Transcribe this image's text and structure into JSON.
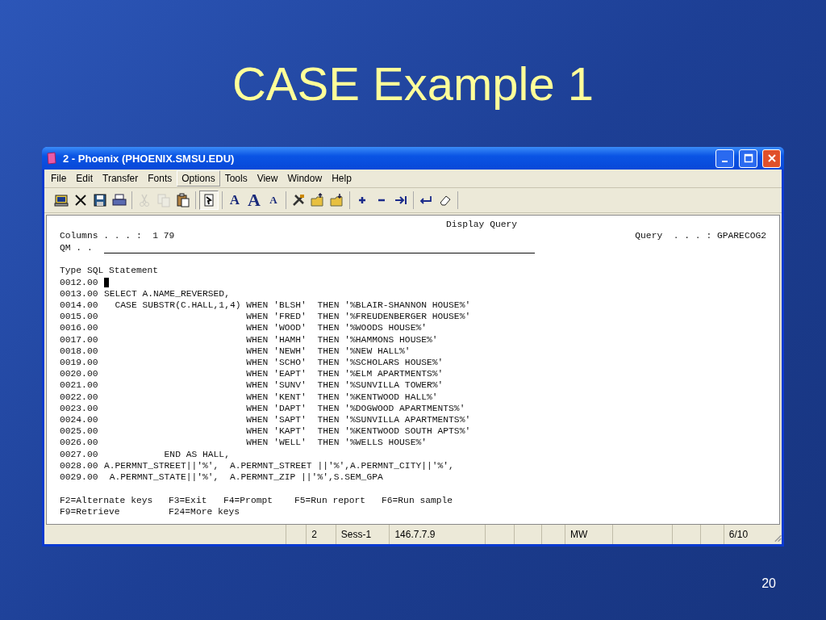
{
  "slide": {
    "title": "CASE Example 1",
    "page_number": "20"
  },
  "window": {
    "title": "2 - Phoenix (PHOENIX.SMSU.EDU)"
  },
  "menu": [
    {
      "label": "File",
      "selected": false
    },
    {
      "label": "Edit",
      "selected": false
    },
    {
      "label": "Transfer",
      "selected": false
    },
    {
      "label": "Fonts",
      "selected": false
    },
    {
      "label": "Options",
      "selected": true
    },
    {
      "label": "Tools",
      "selected": false
    },
    {
      "label": "View",
      "selected": false
    },
    {
      "label": "Window",
      "selected": false
    },
    {
      "label": "Help",
      "selected": false
    }
  ],
  "toolbar": [
    [
      {
        "kind": "monitor",
        "disabled": false
      },
      {
        "kind": "close",
        "disabled": false
      },
      {
        "kind": "save",
        "disabled": false
      },
      {
        "kind": "print",
        "disabled": false
      }
    ],
    [
      {
        "kind": "cut",
        "disabled": true
      },
      {
        "kind": "copy",
        "disabled": true
      },
      {
        "kind": "paste",
        "disabled": false
      }
    ],
    [
      {
        "kind": "page",
        "disabled": false
      }
    ],
    [
      {
        "kind": "font",
        "label": "A",
        "disabled": false
      },
      {
        "kind": "font-up",
        "label": "A",
        "disabled": false
      },
      {
        "kind": "font-down",
        "label": "A",
        "disabled": false
      }
    ],
    [
      {
        "kind": "tools",
        "disabled": false
      },
      {
        "kind": "folder-up",
        "disabled": false
      },
      {
        "kind": "folder-down",
        "disabled": false
      }
    ],
    [
      {
        "kind": "plus",
        "disabled": false
      },
      {
        "kind": "minus",
        "disabled": false
      },
      {
        "kind": "tab",
        "disabled": false
      }
    ],
    [
      {
        "kind": "enter",
        "disabled": false
      },
      {
        "kind": "eraser",
        "disabled": false
      }
    ]
  ],
  "terminal": {
    "heading": "Display Query",
    "columns_label": "Columns . . . :  1 79",
    "query_label": "Query  . . . : GPARECOG2",
    "qm_label": "QM . .",
    "section": "Type SQL Statement",
    "lines": [
      {
        "number": "0012.00",
        "cursor": true
      },
      {
        "number": "0013.00",
        "text": "SELECT A.NAME_REVERSED,",
        "cursor": false
      },
      {
        "number": "0014.00",
        "text": "  CASE SUBSTR(C.HALL,1,4) WHEN 'BLSH'  THEN '%BLAIR-SHANNON HOUSE%'",
        "cursor": false
      },
      {
        "number": "0015.00",
        "text": "                          WHEN 'FRED'  THEN '%FREUDENBERGER HOUSE%'",
        "cursor": false
      },
      {
        "number": "0016.00",
        "text": "                          WHEN 'WOOD'  THEN '%WOODS HOUSE%'",
        "cursor": false
      },
      {
        "number": "0017.00",
        "text": "                          WHEN 'HAMH'  THEN '%HAMMONS HOUSE%'",
        "cursor": false
      },
      {
        "number": "0018.00",
        "text": "                          WHEN 'NEWH'  THEN '%NEW HALL%'",
        "cursor": false
      },
      {
        "number": "0019.00",
        "text": "                          WHEN 'SCHO'  THEN '%SCHOLARS HOUSE%'",
        "cursor": false
      },
      {
        "number": "0020.00",
        "text": "                          WHEN 'EAPT'  THEN '%ELM APARTMENTS%'",
        "cursor": false
      },
      {
        "number": "0021.00",
        "text": "                          WHEN 'SUNV'  THEN '%SUNVILLA TOWER%'",
        "cursor": false
      },
      {
        "number": "0022.00",
        "text": "                          WHEN 'KENT'  THEN '%KENTWOOD HALL%'",
        "cursor": false
      },
      {
        "number": "0023.00",
        "text": "                          WHEN 'DAPT'  THEN '%DOGWOOD APARTMENTS%'",
        "cursor": false
      },
      {
        "number": "0024.00",
        "text": "                          WHEN 'SAPT'  THEN '%SUNVILLA APARTMENTS%'",
        "cursor": false
      },
      {
        "number": "0025.00",
        "text": "                          WHEN 'KAPT'  THEN '%KENTWOOD SOUTH APTS%'",
        "cursor": false
      },
      {
        "number": "0026.00",
        "text": "                          WHEN 'WELL'  THEN '%WELLS HOUSE%'",
        "cursor": false
      },
      {
        "number": "0027.00",
        "text": "           END AS HALL,",
        "cursor": false
      },
      {
        "number": "0028.00",
        "text": "A.PERMNT_STREET||'%',  A.PERMNT_STREET ||'%',A.PERMNT_CITY||'%',",
        "cursor": false
      },
      {
        "number": "0029.00",
        "text": " A.PERMNT_STATE||'%',  A.PERMNT_ZIP ||'%',S.SEM_GPA",
        "cursor": false
      }
    ],
    "function_keys": [
      [
        "F2=Alternate keys",
        "F3=Exit",
        "F4=Prompt",
        "F5=Run report",
        "F6=Run sample"
      ],
      [
        "F9=Retrieve",
        "F24=More keys"
      ]
    ]
  },
  "status_bar": {
    "session_number": "2",
    "session": "Sess-1",
    "address": "146.7.7.9",
    "mode": "MW",
    "position": "6/10"
  }
}
